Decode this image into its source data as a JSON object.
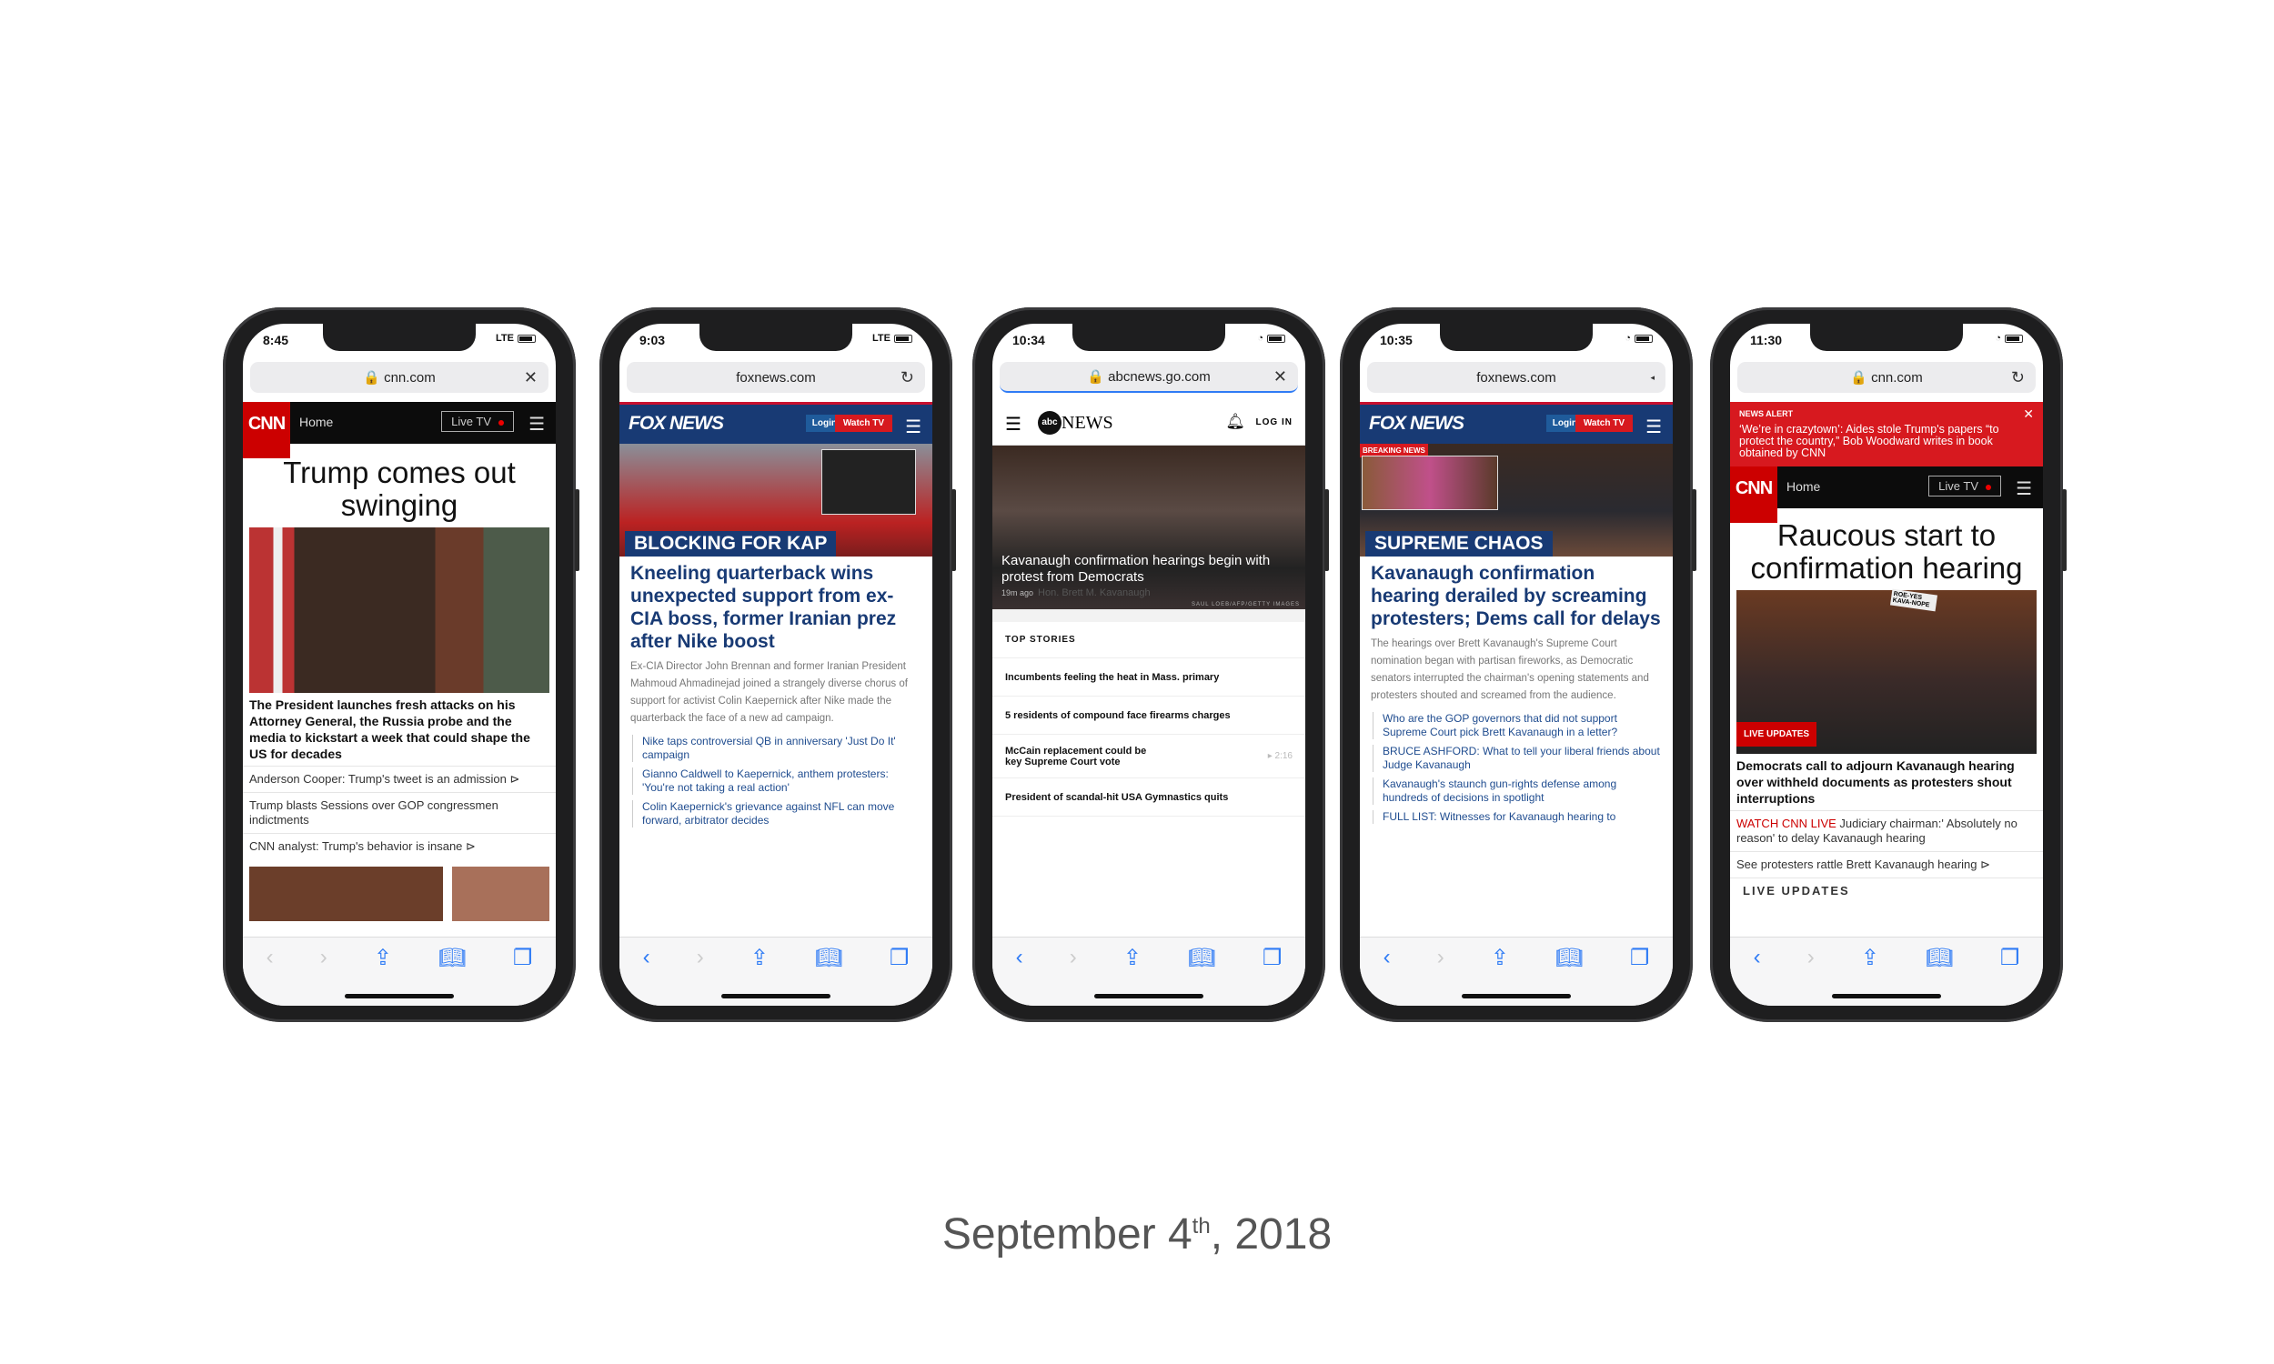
{
  "caption": {
    "month_day": "September 4",
    "sup": "th",
    "year": ", 2018"
  },
  "phones": [
    {
      "time": "8:45",
      "network": "LTE",
      "url": "cnn.com",
      "url_action": "close",
      "nav": {
        "logo": "CNN",
        "home": "Home",
        "live": "Live TV"
      },
      "headline": "Trump comes out swinging",
      "caption": "The President launches fresh attacks on his Attorney General, the Russia probe and the media to kickstart a week that could shape the US for decades",
      "links": [
        "Anderson Cooper: Trump's tweet is an admission",
        "Trump blasts Sessions over GOP congressmen indictments",
        "CNN analyst: Trump's behavior is insane"
      ]
    },
    {
      "time": "9:03",
      "network": "LTE",
      "url": "foxnews.com",
      "url_action": "reload",
      "nav": {
        "logo": "FOX NEWS",
        "login": "Login",
        "watch": "Watch TV"
      },
      "banner": "BLOCKING FOR KAP",
      "headline": "Kneeling quarterback wins unexpected support from ex-CIA boss, former Iranian prez after Nike boost",
      "summary": "Ex-CIA Director John Brennan and former Iranian President Mahmoud Ahmadinejad joined a strangely diverse chorus of support for activist Colin Kaepernick after Nike made the quarterback the face of a new ad campaign.",
      "links": [
        "Nike taps controversial QB in anniversary 'Just Do It' campaign",
        "Gianno Caldwell to Kaepernick, anthem protesters: 'You're not taking a real action'",
        "Colin Kaepernick's grievance against NFL can move forward, arbitrator decides"
      ]
    },
    {
      "time": "10:34",
      "url": "abcnews.go.com",
      "url_action": "close",
      "nav": {
        "logo_abc": "abc",
        "logo_news": "NEWS",
        "login": "LOG IN"
      },
      "hero": "Kavanaugh confirmation hearings begin with protest from Democrats",
      "hero_age": "19m ago",
      "nameplate": "Hon. Brett M. Kavanaugh",
      "credit": "SAUL LOEB/AFP/GETTY IMAGES",
      "section": "TOP STORIES",
      "stories": [
        "Incumbents feeling the heat in Mass. primary",
        "5 residents of compound face firearms charges",
        "McCain replacement could be key Supreme Court vote",
        "President of scandal-hit USA Gymnastics quits"
      ],
      "video_duration": "2:16"
    },
    {
      "time": "10:35",
      "url": "foxnews.com",
      "url_action": "reader",
      "nav": {
        "logo": "FOX NEWS",
        "login": "Login",
        "watch": "Watch TV"
      },
      "breaking": "BREAKING NEWS",
      "banner": "SUPREME CHAOS",
      "headline": "Kavanaugh confirmation hearing derailed by screaming protesters; Dems call for delays",
      "summary": "The hearings over Brett Kavanaugh's Supreme Court nomination began with partisan fireworks, as Democratic senators interrupted the chairman's opening statements and protesters shouted and screamed from the audience.",
      "links": [
        "Who are the GOP governors that did not support Supreme Court pick Brett Kavanaugh in a letter?",
        "BRUCE ASHFORD: What to tell your liberal friends about Judge Kavanaugh",
        "Kavanaugh's staunch gun-rights defense among hundreds of decisions in spotlight",
        "FULL LIST: Witnesses for Kavanaugh hearing to"
      ]
    },
    {
      "time": "11:30",
      "url": "cnn.com",
      "url_action": "reload",
      "alert": {
        "label": "NEWS ALERT",
        "text": "‘We’re in crazytown’: Aides stole Trump's papers “to protect the country,” Bob Woodward writes in book obtained by CNN"
      },
      "nav": {
        "logo": "CNN",
        "home": "Home",
        "live": "Live TV"
      },
      "headline": "Raucous start to confirmation hearing",
      "badge": "LIVE UPDATES",
      "sign": "ROE-YES KAVA-NOPE",
      "caption": "Democrats call to adjourn Kavanaugh hearing over withheld documents as protesters shout interruptions",
      "watch": "WATCH CNN LIVE",
      "watch_text": " Judiciary chairman:' Absolutely no reason' to delay Kavanaugh hearing",
      "links": [
        "See protesters rattle Brett Kavanaugh hearing",
        "LIVE UPDATES"
      ]
    }
  ],
  "colors": {
    "cnn_red": "#cc0000",
    "fox_blue": "#183a74",
    "fox_red": "#d7191f",
    "safari_blue": "#2f7bf5"
  }
}
